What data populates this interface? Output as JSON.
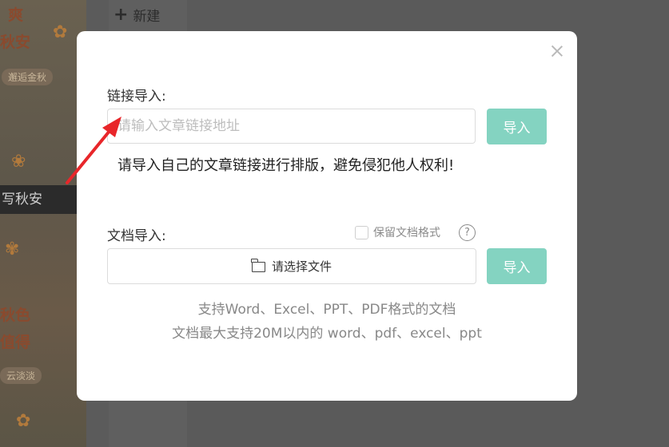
{
  "background": {
    "left_panel": {
      "lines": [
        "爽",
        "秋安",
        "邂逅金秋",
        "写秋安",
        "秋色",
        "值得",
        "云淡淡"
      ]
    },
    "new_button_label": "新建"
  },
  "modal": {
    "link_section": {
      "label": "链接导入:",
      "input_placeholder": "请输入文章链接地址",
      "input_value": "",
      "import_label": "导入",
      "warning": "请导入自己的文章链接进行排版，避免侵犯他人权利!"
    },
    "doc_section": {
      "label": "文档导入:",
      "keep_format_label": "保留文档格式",
      "keep_format_checked": false,
      "help_glyph": "?",
      "choose_file_label": "请选择文件",
      "import_label": "导入",
      "support_line1": "支持Word、Excel、PPT、PDF格式的文档",
      "support_line2": "文档最大支持20M以内的 word、pdf、excel、ppt"
    }
  },
  "colors": {
    "accent_button": "#84d3c1",
    "annotation_arrow": "#e8262a"
  },
  "icons": {
    "close": "close-icon",
    "folder": "folder-icon",
    "help": "help-icon",
    "plus": "plus-icon"
  }
}
